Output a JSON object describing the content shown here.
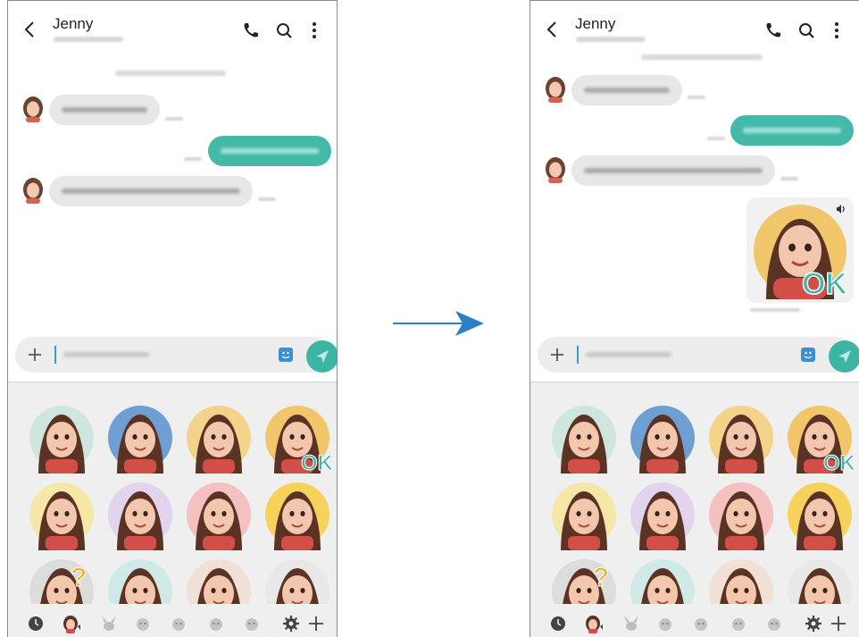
{
  "contact": {
    "name": "Jenny"
  },
  "arrow_color": "#2e7fc9",
  "accent_color": "#3cb5a4",
  "header_icons": [
    "back-arrow-icon",
    "phone-call-icon",
    "search-icon",
    "more-options-icon"
  ],
  "messages": [
    {
      "direction": "incoming",
      "type": "text"
    },
    {
      "direction": "outgoing",
      "type": "text"
    },
    {
      "direction": "incoming",
      "type": "text"
    }
  ],
  "sent_sticker": {
    "caption": "OK"
  },
  "input": {
    "placeholder": ""
  },
  "sticker_grid": {
    "rows": 3,
    "columns": 4,
    "stickers": [
      {
        "id": "laughing",
        "bg": "#cfe6df"
      },
      {
        "id": "peace-sign",
        "bg": "#6e9fd3"
      },
      {
        "id": "triangle-bg",
        "bg": "#f3d38a"
      },
      {
        "id": "ok",
        "bg": "#f1c66a",
        "text": "OK"
      },
      {
        "id": "party",
        "bg": "#f4e7a8"
      },
      {
        "id": "heart",
        "bg": "#e2d3ef"
      },
      {
        "id": "kiss",
        "bg": "#f4c0c0"
      },
      {
        "id": "star-bg",
        "bg": "#f6d25a"
      },
      {
        "id": "question",
        "bg": "#dcdcdc",
        "text": "?"
      },
      {
        "id": "ghost",
        "bg": "#cfeae6"
      },
      {
        "id": "leaf",
        "bg": "#f0e0d6"
      },
      {
        "id": "sparkle",
        "bg": "#e8e8e8"
      }
    ]
  },
  "sticker_tabs": [
    "recent-clock-icon",
    "ar-emoji-icon",
    "rabbit-icon",
    "sticker-pack-icon",
    "sticker-pack-icon",
    "sticker-pack-icon",
    "sticker-pack-icon",
    "settings-gear-icon",
    "add-plus-icon"
  ]
}
